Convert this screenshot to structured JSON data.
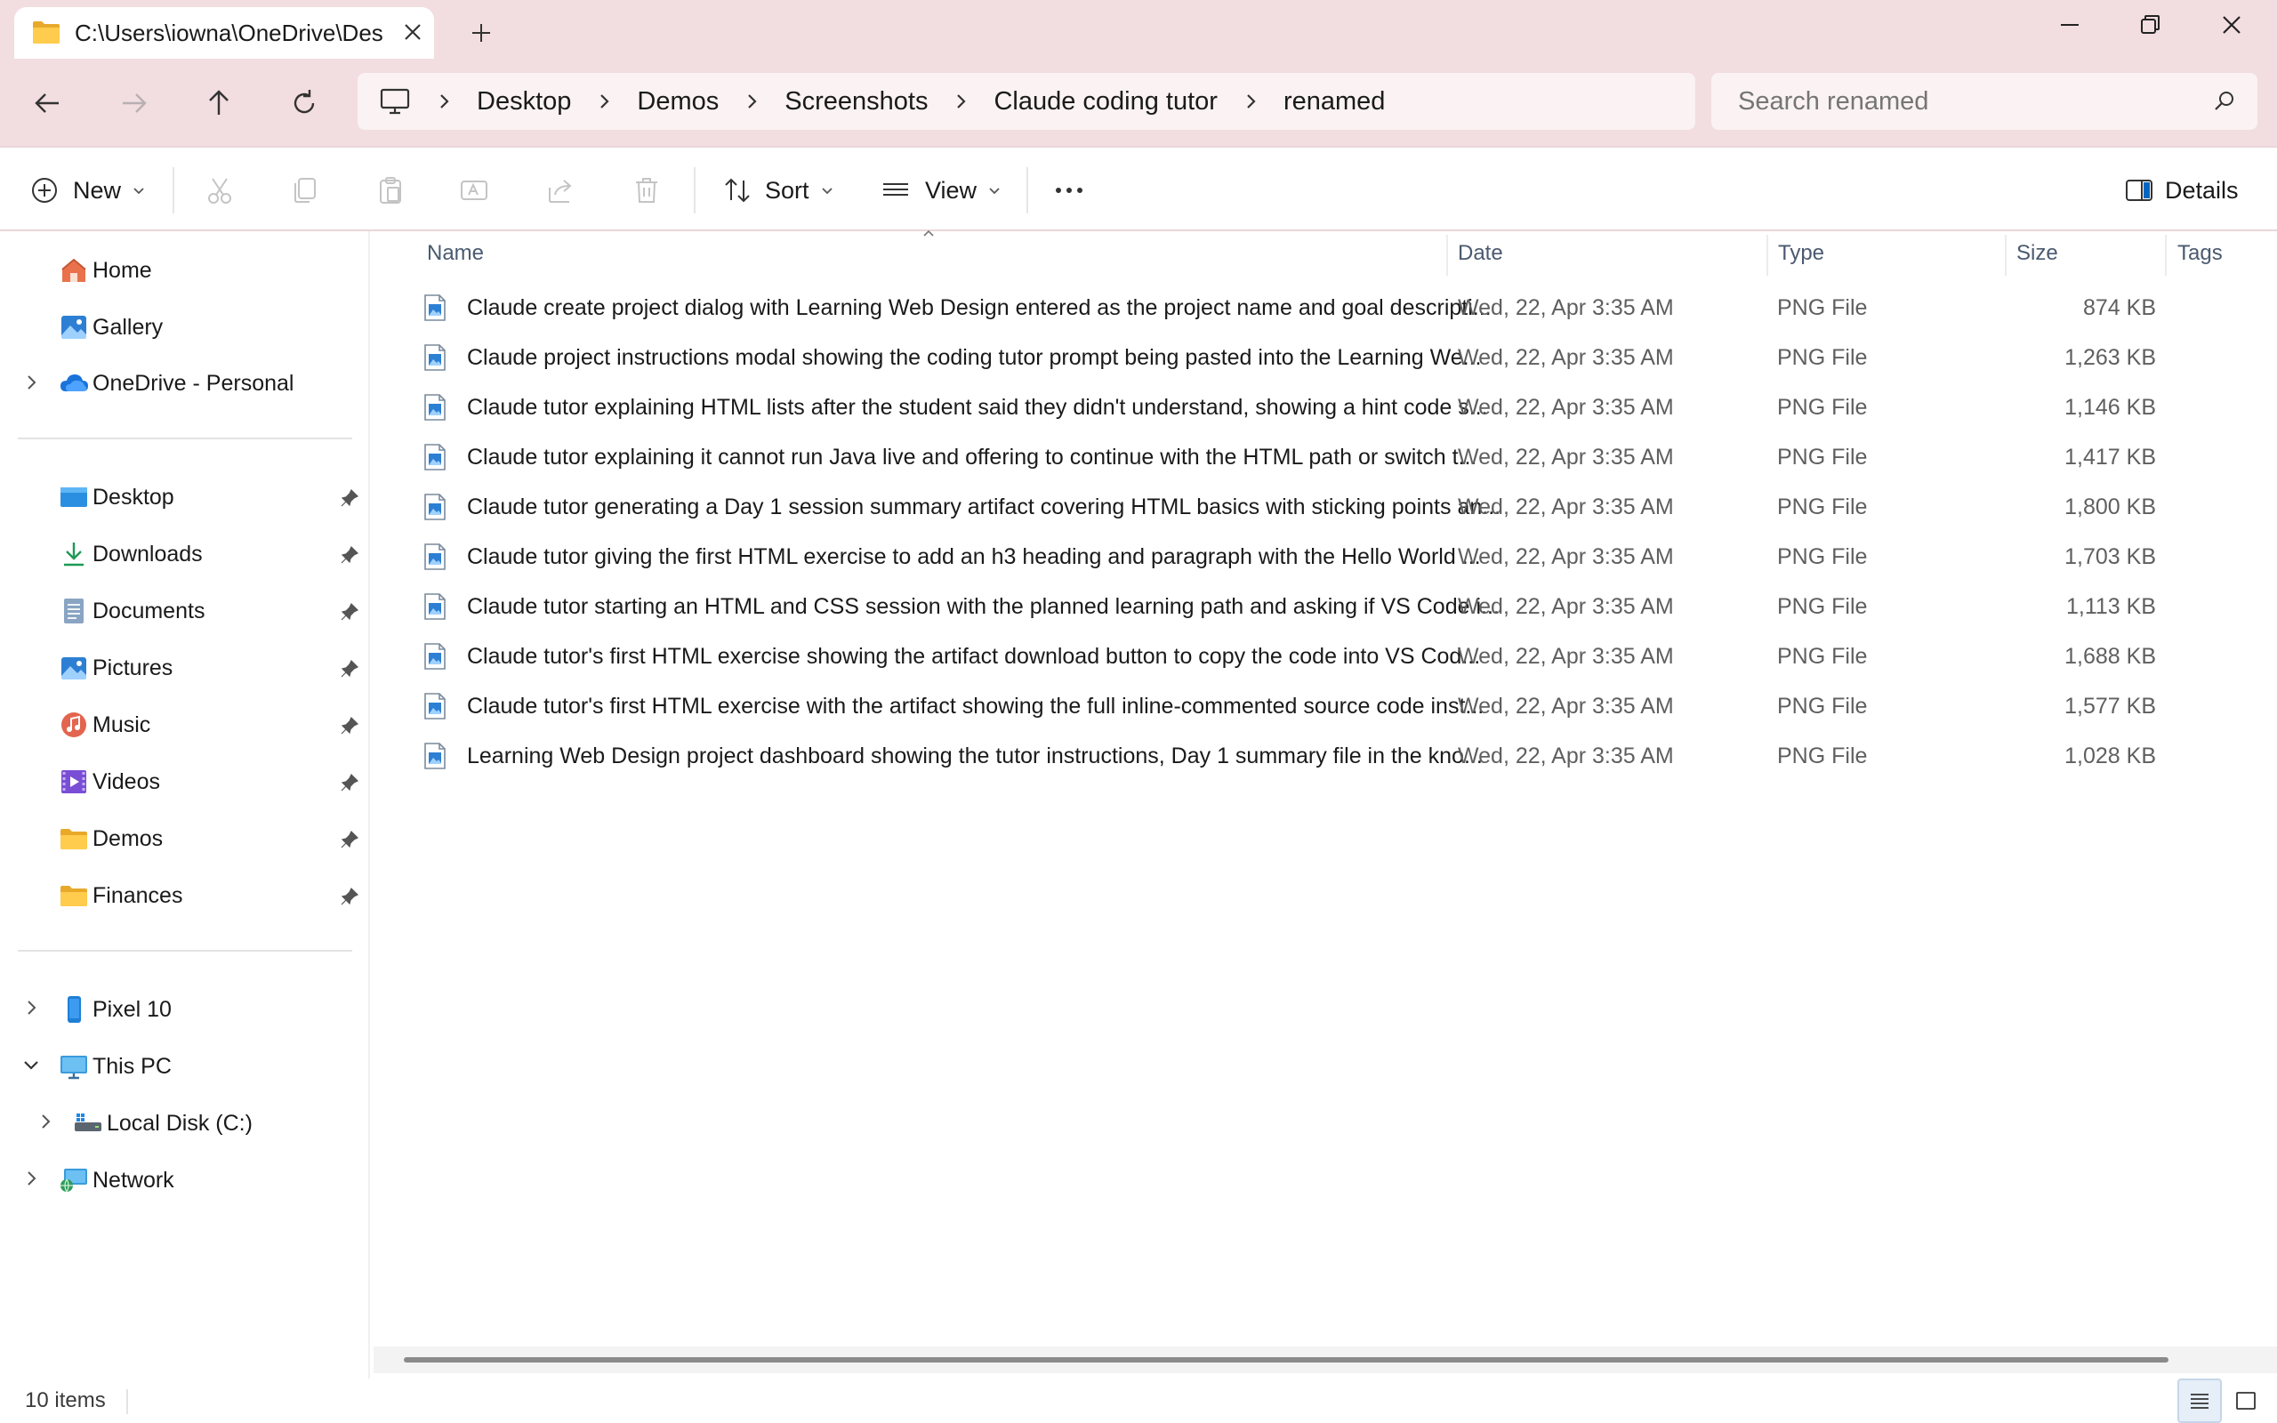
{
  "window": {
    "tab_title": "C:\\Users\\iowna\\OneDrive\\Desktop\\Demos\\Screenshots\\Claude coding tutor\\renamed"
  },
  "breadcrumb": {
    "items": [
      "Desktop",
      "Demos",
      "Screenshots",
      "Claude coding tutor",
      "renamed"
    ]
  },
  "search": {
    "placeholder": "Search renamed"
  },
  "toolbar": {
    "new_label": "New",
    "sort_label": "Sort",
    "view_label": "View",
    "details_label": "Details"
  },
  "sidebar": {
    "top": [
      {
        "label": "Home",
        "icon": "home-icon"
      },
      {
        "label": "Gallery",
        "icon": "gallery-icon"
      },
      {
        "label": "OneDrive - Personal",
        "icon": "onedrive-icon"
      }
    ],
    "pinned": [
      {
        "label": "Desktop",
        "icon": "desktop-folder-icon"
      },
      {
        "label": "Downloads",
        "icon": "downloads-icon"
      },
      {
        "label": "Documents",
        "icon": "documents-icon"
      },
      {
        "label": "Pictures",
        "icon": "pictures-icon"
      },
      {
        "label": "Music",
        "icon": "music-icon"
      },
      {
        "label": "Videos",
        "icon": "videos-icon"
      },
      {
        "label": "Demos",
        "icon": "folder-icon"
      },
      {
        "label": "Finances",
        "icon": "folder-icon"
      }
    ],
    "devices": [
      {
        "label": "Pixel 10",
        "icon": "phone-icon"
      },
      {
        "label": "This PC",
        "icon": "this-pc-icon"
      },
      {
        "label": "Local Disk (C:)",
        "icon": "drive-icon"
      },
      {
        "label": "Network",
        "icon": "network-icon"
      }
    ]
  },
  "columns": {
    "name": "Name",
    "date": "Date",
    "type": "Type",
    "size": "Size",
    "tags": "Tags"
  },
  "files": [
    {
      "name": "Claude create project dialog with Learning Web Design entered as the project name and goal descripti...",
      "date": "Wed, 22, Apr 3:35 AM",
      "type": "PNG File",
      "size": "874 KB"
    },
    {
      "name": "Claude project instructions modal showing the coding tutor prompt being pasted into the Learning We...",
      "date": "Wed, 22, Apr 3:35 AM",
      "type": "PNG File",
      "size": "1,263 KB"
    },
    {
      "name": "Claude tutor explaining HTML lists after the student said they didn't understand, showing a hint code s...",
      "date": "Wed, 22, Apr 3:35 AM",
      "type": "PNG File",
      "size": "1,146 KB"
    },
    {
      "name": "Claude tutor explaining it cannot run Java live and offering to continue with the HTML path or switch t...",
      "date": "Wed, 22, Apr 3:35 AM",
      "type": "PNG File",
      "size": "1,417 KB"
    },
    {
      "name": "Claude tutor generating a Day 1 session summary artifact covering HTML basics with sticking points an...",
      "date": "Wed, 22, Apr 3:35 AM",
      "type": "PNG File",
      "size": "1,800 KB"
    },
    {
      "name": "Claude tutor giving the first HTML exercise to add an h3 heading and paragraph with the Hello World ...",
      "date": "Wed, 22, Apr 3:35 AM",
      "type": "PNG File",
      "size": "1,703 KB"
    },
    {
      "name": "Claude tutor starting an HTML and CSS session with the planned learning path and asking if VS Code i...",
      "date": "Wed, 22, Apr 3:35 AM",
      "type": "PNG File",
      "size": "1,113 KB"
    },
    {
      "name": "Claude tutor's first HTML exercise showing the artifact download button to copy the code into VS Cod...",
      "date": "Wed, 22, Apr 3:35 AM",
      "type": "PNG File",
      "size": "1,688 KB"
    },
    {
      "name": "Claude tutor's first HTML exercise with the artifact showing the full inline-commented source code inst...",
      "date": "Wed, 22, Apr 3:35 AM",
      "type": "PNG File",
      "size": "1,577 KB"
    },
    {
      "name": "Learning Web Design project dashboard showing the tutor instructions, Day 1 summary file in the kno...",
      "date": "Wed, 22, Apr 3:35 AM",
      "type": "PNG File",
      "size": "1,028 KB"
    }
  ],
  "status": {
    "item_count": "10 items"
  },
  "colors": {
    "titlebar": "#f2dde0",
    "field_bg": "#faf2f3",
    "accent": "#0067c0"
  }
}
